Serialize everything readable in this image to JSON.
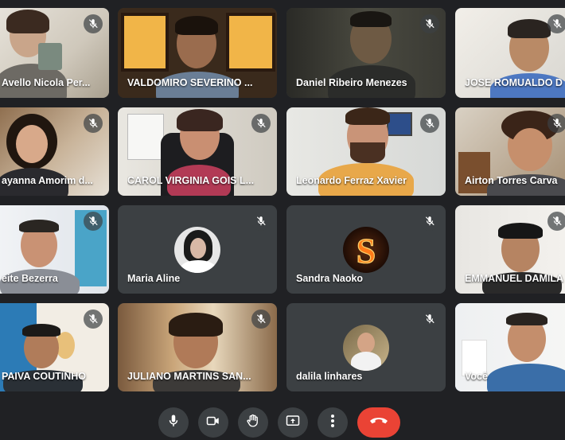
{
  "participants": [
    {
      "name": "Avello Nicola Per...",
      "muted": true
    },
    {
      "name": "VALDOMIRO SEVERINO ...",
      "muted": false
    },
    {
      "name": "Daniel Ribeiro Menezes",
      "muted": true
    },
    {
      "name": "JOSE ROMUALDO D",
      "muted": true
    },
    {
      "name": "ayanna Amorim d...",
      "muted": true
    },
    {
      "name": "CAROL VIRGINIA GOIS L...",
      "muted": true
    },
    {
      "name": "Leonardo Ferraz Xavier",
      "muted": true
    },
    {
      "name": "Airton Torres Carva",
      "muted": true
    },
    {
      "name": "eite Bezerra",
      "muted": true
    },
    {
      "name": "Maria Aline",
      "muted": true
    },
    {
      "name": "Sandra Naoko",
      "muted": true
    },
    {
      "name": "EMMANUEL DAMILA",
      "muted": true
    },
    {
      "name": "PAIVA COUTINHO",
      "muted": true
    },
    {
      "name": "JULIANO MARTINS SAN...",
      "muted": true
    },
    {
      "name": "dalila linhares",
      "muted": true
    },
    {
      "name": "Você",
      "muted": false
    }
  ],
  "controls": {
    "mic_icon": "mic-icon",
    "camera_icon": "videocam-icon",
    "hand_icon": "raise-hand-icon",
    "present_icon": "present-screen-icon",
    "more_icon": "more-vert-icon",
    "hangup_icon": "call-end-icon"
  },
  "colors": {
    "background": "#202124",
    "tile": "#3c4043",
    "hangup": "#ea4335",
    "self_border": "#8ab4f8"
  }
}
